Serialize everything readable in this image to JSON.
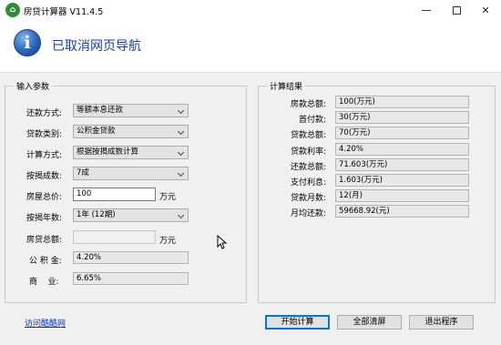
{
  "window": {
    "title": "房贷计算器 V11.4.5",
    "icon_name": "house-app-icon"
  },
  "banner": {
    "icon_name": "info-icon",
    "message": "已取消网页导航"
  },
  "input_group": {
    "title": "输入参数",
    "repayment_method": {
      "label": "还款方式:",
      "value": "等额本息还款"
    },
    "loan_type": {
      "label": "贷款类别:",
      "value": "公积金贷款"
    },
    "calc_method": {
      "label": "计算方式:",
      "value": "根据按揭成数计算"
    },
    "mortgage_ratio": {
      "label": "按揭成数:",
      "value": "7成"
    },
    "house_price": {
      "label": "房屋总价:",
      "value": "100",
      "unit": "万元"
    },
    "mortgage_years": {
      "label": "按揭年数:",
      "value": "1年 (12期)"
    },
    "loan_total": {
      "label": "房贷总额:",
      "value": "",
      "unit": "万元"
    },
    "fund_rate": {
      "label": "公 积 金:",
      "value": "4.20%"
    },
    "commercial_rate": {
      "label": "商    业:",
      "value": "6.65%"
    }
  },
  "result_group": {
    "title": "计算结果",
    "rows": [
      {
        "label": "房款总额:",
        "value": "100(万元)"
      },
      {
        "label": "首付款:",
        "value": "30(万元)"
      },
      {
        "label": "贷款总额:",
        "value": "70(万元)"
      },
      {
        "label": "贷款利率:",
        "value": "4.20%"
      },
      {
        "label": "还款总额:",
        "value": "71.603(万元)"
      },
      {
        "label": "支付利息:",
        "value": "1.603(万元)"
      },
      {
        "label": "贷款月数:",
        "value": "12(月)"
      },
      {
        "label": "月均还款:",
        "value": "59668.92(元)"
      }
    ]
  },
  "footer": {
    "link": "访问酷酷网",
    "start_button": "开始计算",
    "clear_button": "全部清屏",
    "exit_button": "退出程序"
  },
  "colors": {
    "accent": "#0078d7",
    "banner_text": "#1a3fa0",
    "link": "#0033cc"
  }
}
